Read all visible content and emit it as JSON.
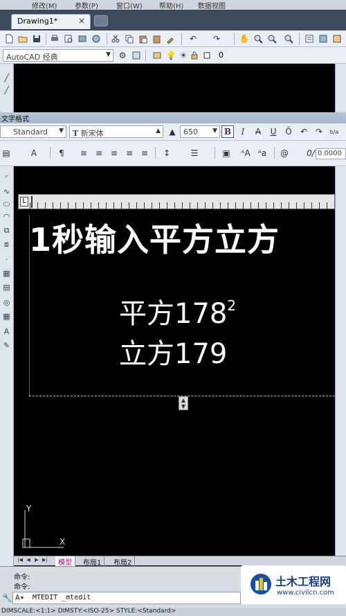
{
  "menubar": {
    "items": [
      "修改(M)",
      "参数(P)",
      "窗口(W)",
      "帮助(H)",
      "数据视图"
    ]
  },
  "document_tab": {
    "title": "Drawing1*",
    "close": "×"
  },
  "workspace": {
    "value": "AutoCAD 经典"
  },
  "layer": {
    "name": "0"
  },
  "text_formatting": {
    "title": "文字格式",
    "style": "Standard",
    "font": "新宋体",
    "height": "650",
    "bold": "B",
    "italic": "I",
    "strike": "A",
    "underline": "U",
    "overline": "Ō",
    "stack": "b/a",
    "letter_spacing_value": "0.0000"
  },
  "editor": {
    "heading": "1秒输入平方立方",
    "line1_text": "平方178",
    "line1_sup": "2",
    "line2_text": "立方179"
  },
  "ucs": {
    "y_label": "Y",
    "x_label": "X"
  },
  "layout_tabs": {
    "model": "模型",
    "layout1": "布局1",
    "layout2": "布局2"
  },
  "command": {
    "history": [
      "命令:",
      "命令:"
    ],
    "input": "MTEDIT _mtedit"
  },
  "status": {
    "text": "DIMSCALE:<1:1> DIMSTY:<ISO-25> STYLE:<Standard>"
  },
  "watermark": {
    "name": "土木工程网",
    "url": "www.civilcn.com"
  }
}
